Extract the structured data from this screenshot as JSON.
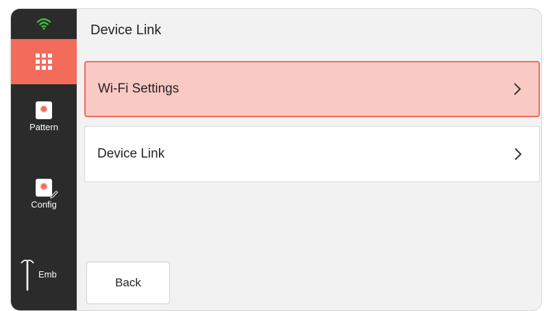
{
  "page": {
    "title": "Device Link"
  },
  "sidebar": {
    "status_icon": "wifi-icon",
    "home_icon": "grid-icon",
    "items": [
      {
        "label": "Pattern",
        "icon": "pattern-card-icon"
      },
      {
        "label": "Config",
        "icon": "config-card-icon"
      },
      {
        "label": "Emb",
        "icon": "needle-icon"
      }
    ]
  },
  "menu": {
    "items": [
      {
        "label": "Wi-Fi Settings",
        "selected": true,
        "icon": "chevron-right-icon"
      },
      {
        "label": "Device Link",
        "selected": false,
        "icon": "chevron-right-icon"
      }
    ]
  },
  "footer": {
    "back_label": "Back"
  },
  "colors": {
    "accent": "#f26b5b",
    "selected_bg": "#f9c9c4",
    "sidebar_bg": "#2b2b2b",
    "wifi_status": "#3cc43c"
  }
}
